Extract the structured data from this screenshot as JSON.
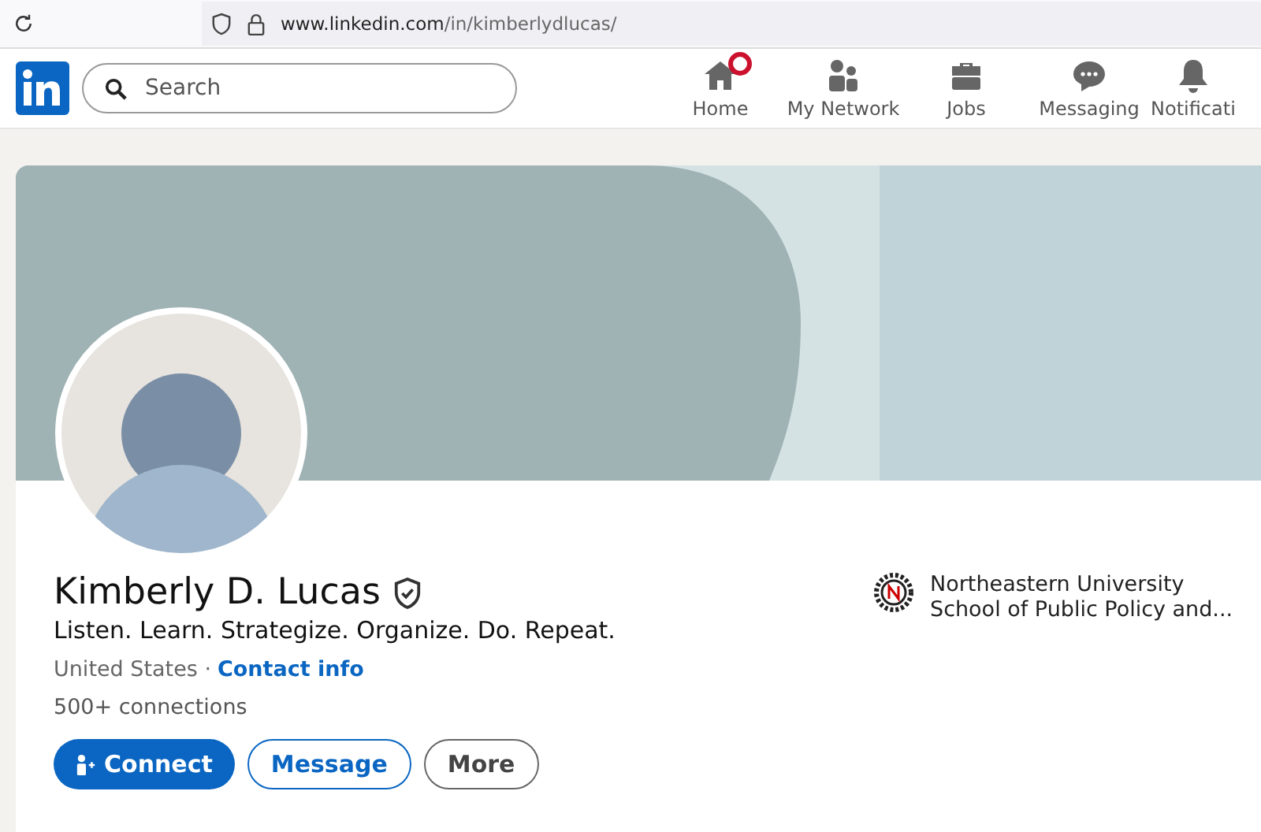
{
  "browser": {
    "url_host": "www.linkedin.com",
    "url_path": "/in/kimberlydlucas/"
  },
  "nav": {
    "search": {
      "placeholder": "Search"
    },
    "items": [
      {
        "label": "Home",
        "kind": "home",
        "badge": true
      },
      {
        "label": "My Network",
        "kind": "network",
        "badge": false
      },
      {
        "label": "Jobs",
        "kind": "jobs",
        "badge": false
      },
      {
        "label": "Messaging",
        "kind": "messaging",
        "badge": false
      },
      {
        "label": "Notificati",
        "kind": "notifications",
        "badge": false
      }
    ]
  },
  "profile": {
    "name": "Kimberly D. Lucas",
    "verified": true,
    "headline": "Listen. Learn. Strategize. Organize. Do. Repeat.",
    "location": "United States",
    "separator": "·",
    "contact_link": "Contact info",
    "connections": "500+ connections",
    "education": [
      "Northeastern University",
      "School of Public Policy and..."
    ],
    "buttons": [
      {
        "label": "Connect",
        "kind": "primary"
      },
      {
        "label": "Message",
        "kind": "outline"
      },
      {
        "label": "More",
        "kind": "neutral"
      }
    ]
  }
}
